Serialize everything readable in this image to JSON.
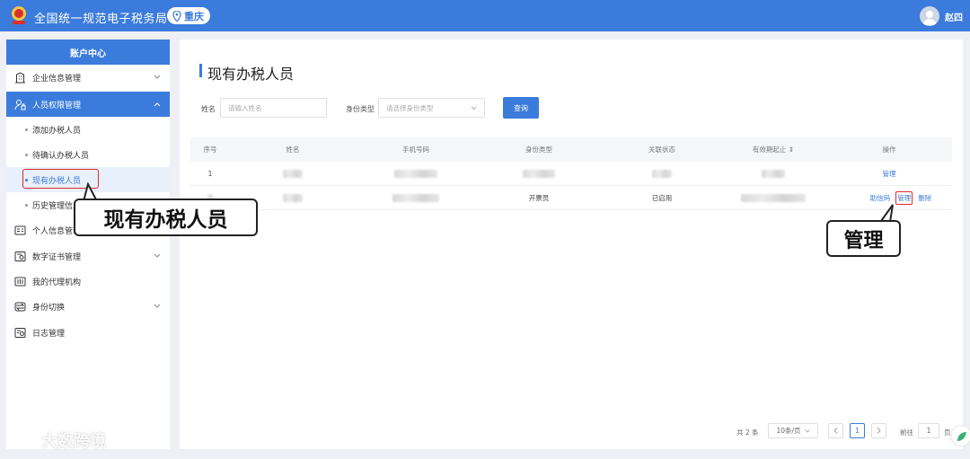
{
  "header": {
    "app_title": "全国统一规范电子税务局",
    "region": "重庆",
    "user_name": "赵四"
  },
  "sidebar": {
    "title": "账户中心",
    "items": [
      {
        "label": "企业信息管理",
        "icon": "building-icon",
        "expandable": true
      },
      {
        "label": "人员权限管理",
        "icon": "user-lock-icon",
        "expandable": true,
        "active": true
      },
      {
        "label": "个人信息管理",
        "icon": "id-card-icon",
        "expandable": false
      },
      {
        "label": "数字证书管理",
        "icon": "certificate-icon",
        "expandable": true
      },
      {
        "label": "我的代理机构",
        "icon": "agency-icon",
        "expandable": false
      },
      {
        "label": "身份切换",
        "icon": "switch-icon",
        "expandable": true
      },
      {
        "label": "日志管理",
        "icon": "log-icon",
        "expandable": false
      }
    ],
    "subitems": [
      {
        "label": "添加办税人员"
      },
      {
        "label": "待确认办税人员"
      },
      {
        "label": "现有办税人员",
        "selected": true
      },
      {
        "label": "历史管理信息"
      }
    ]
  },
  "main": {
    "page_title": "现有办税人员",
    "filters": {
      "name_label": "姓名",
      "name_placeholder": "请输入姓名",
      "type_label": "身份类型",
      "type_placeholder": "请选择身份类型",
      "query_button": "查询"
    },
    "table": {
      "columns": [
        "序号",
        "姓名",
        "手机号码",
        "身份类型",
        "关联状态",
        "有效期起止 ⇕",
        "操作"
      ],
      "rows": [
        {
          "index": "1",
          "type": "",
          "status": "",
          "actions": [
            "管理"
          ]
        },
        {
          "index": "2",
          "type": "开票员",
          "status": "已启用",
          "actions": [
            "助信码",
            "管理",
            "删除"
          ]
        }
      ]
    },
    "pagination": {
      "total": "共 2 条",
      "page_size": "10条/页",
      "current_page": "1",
      "goto_label": "前往",
      "goto_value": "1",
      "page_unit": "页"
    }
  },
  "callouts": {
    "current_staff": "现有办税人员",
    "manage": "管理"
  },
  "watermark": "大数跨境",
  "colors": {
    "primary": "#3b7bdc",
    "highlight": "#e0282e"
  }
}
